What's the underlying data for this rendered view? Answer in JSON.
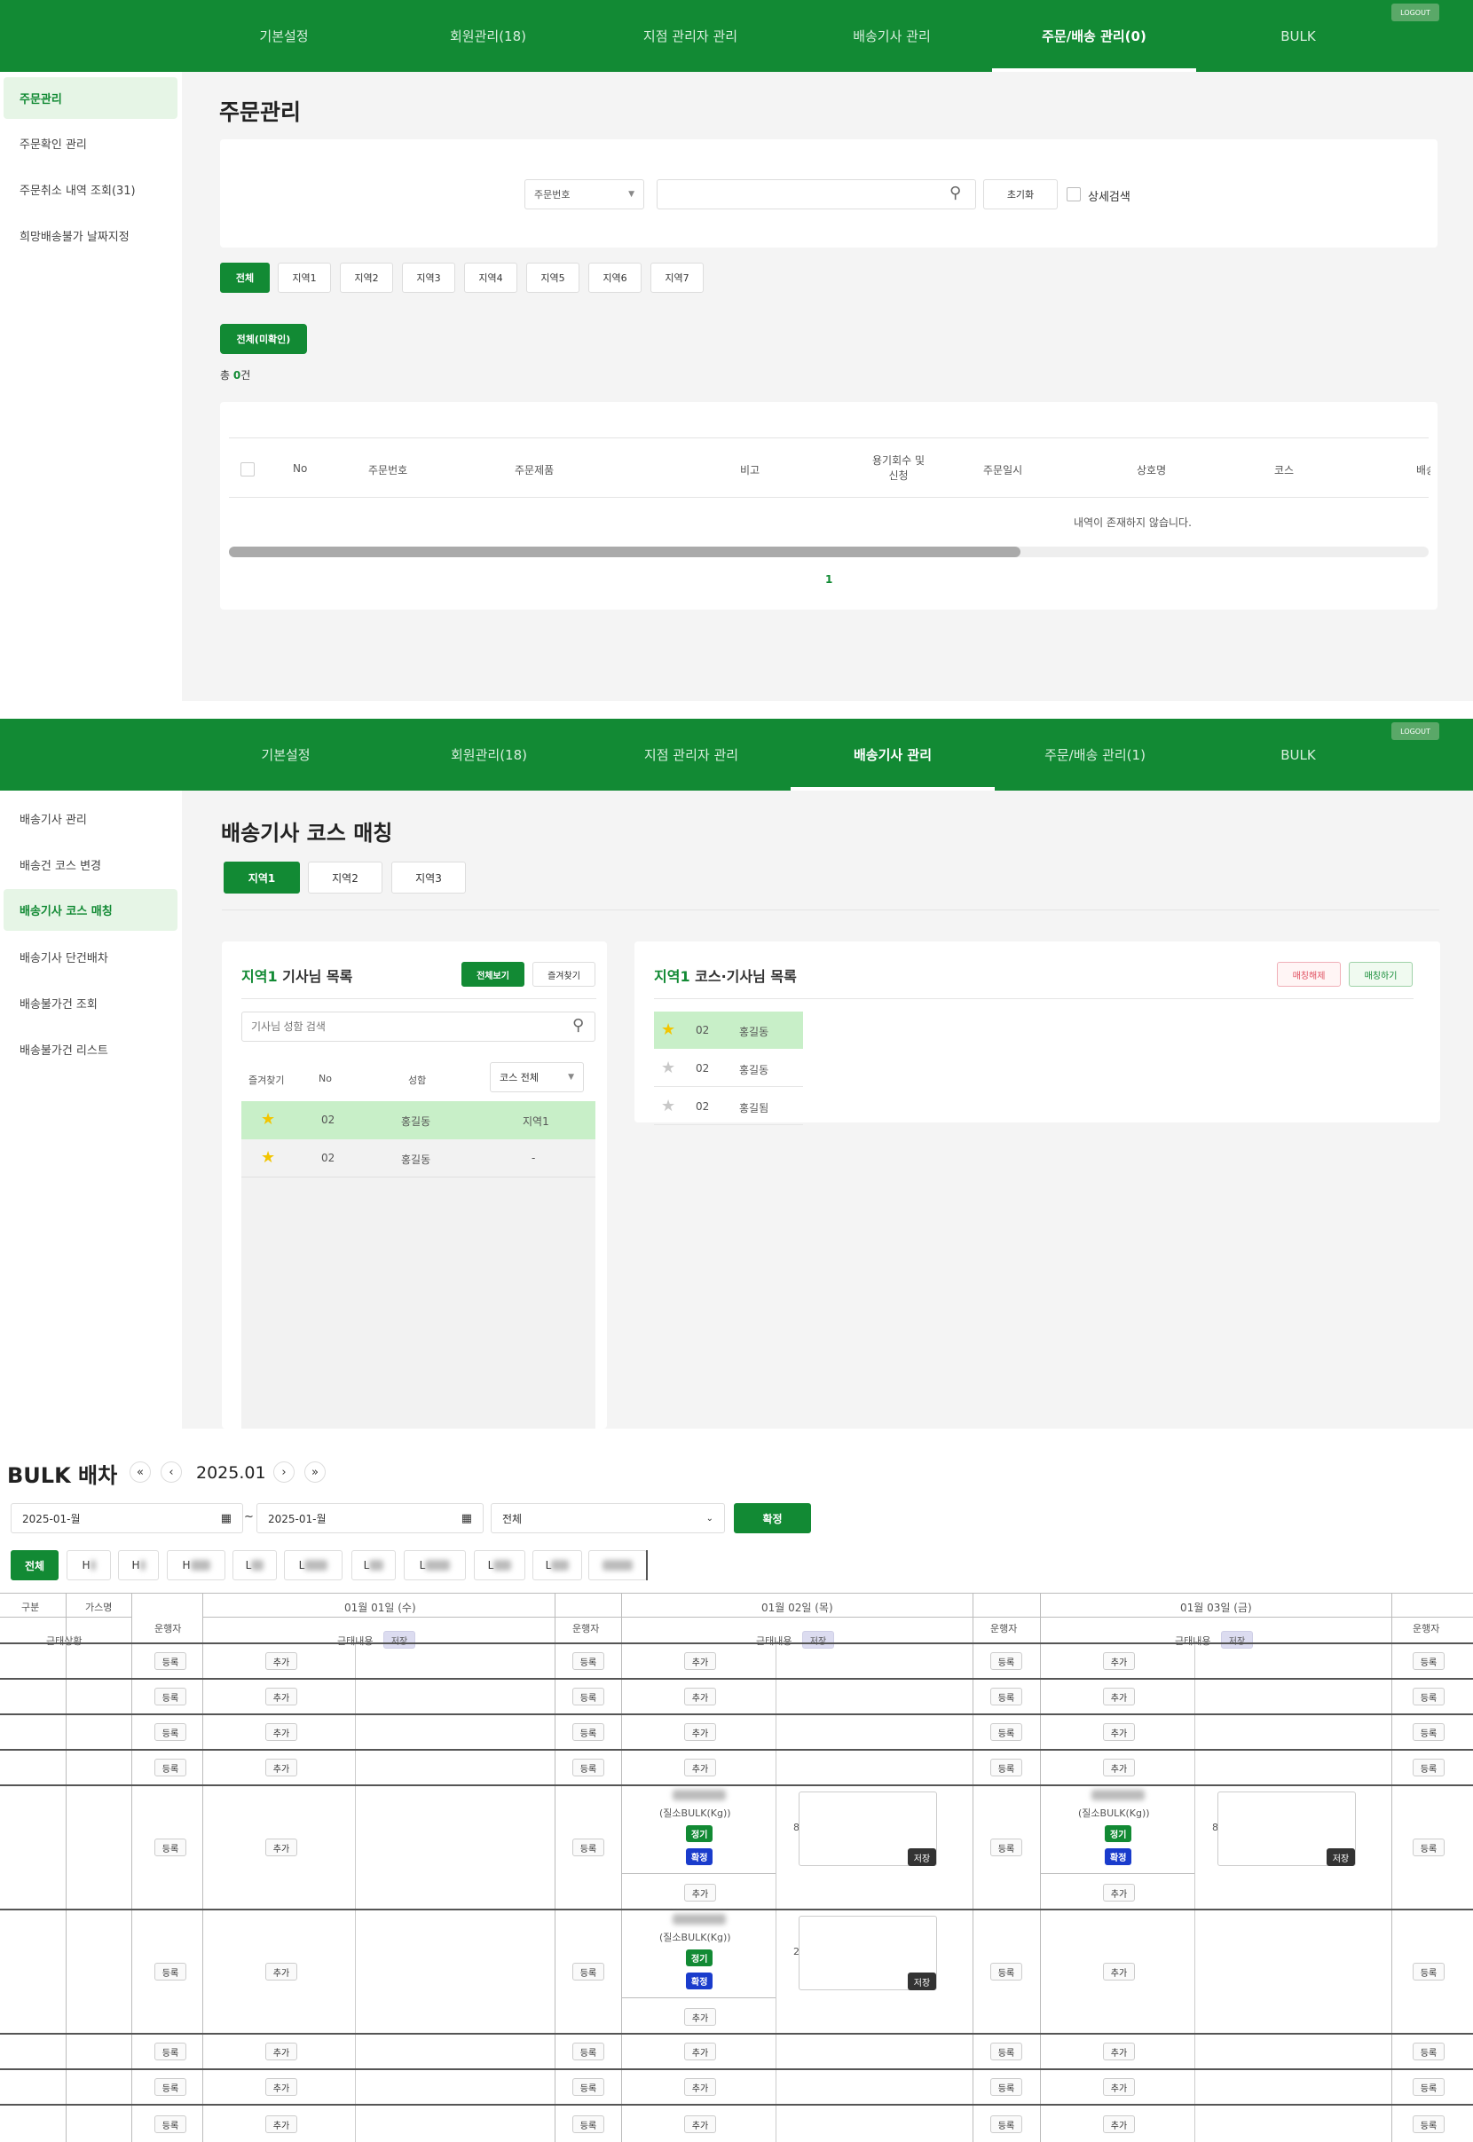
{
  "nav_items": [
    "기본설정",
    "회원관리(18)",
    "지점 관리자 관리",
    "배송기사 관리",
    "주문/배송 관리(0)",
    "BULK"
  ],
  "nav_items_2": [
    "기본설정",
    "회원관리(18)",
    "지점 관리자 관리",
    "배송기사 관리",
    "주문/배송 관리(1)",
    "BULK"
  ],
  "logout": "LOGOUT",
  "s1": {
    "sidebar": [
      "주문관리",
      "주문확인 관리",
      "주문취소 내역 조회(31)",
      "희망배송불가 날짜지정"
    ],
    "title": "주문관리",
    "search_select": "주문번호",
    "search_placeholder": "",
    "reset": "초기화",
    "detail_search": "상세검색",
    "regions": [
      "전체",
      "지역1",
      "지역2",
      "지역3",
      "지역4",
      "지역5",
      "지역6",
      "지역7"
    ],
    "unconfirmed": "전체(미확인)",
    "total_prefix": "총 ",
    "total_count": "0",
    "total_suffix": "건",
    "columns": [
      "No",
      "주문번호",
      "주문제품",
      "비고",
      "용기회수 및\n신청",
      "주문일시",
      "상호명",
      "코스",
      "배송"
    ],
    "empty": "내역이 존재하지 않습니다.",
    "page": "1"
  },
  "s2": {
    "sidebar": [
      "배송기사 관리",
      "배송건 코스 변경",
      "배송기사 코스 매칭",
      "배송기사 단건배차",
      "배송불가건 조회",
      "배송불가건 리스트"
    ],
    "title": "배송기사 코스 매칭",
    "tabs": [
      "지역1",
      "지역2",
      "지역3"
    ],
    "left_title_accent": "지역1",
    "left_title_rest": " 기사님 목록",
    "view_all": "전체보기",
    "favorites": "즐겨찾기",
    "driver_search_placeholder": "기사님 성함 검색",
    "cols": [
      "즐겨찾기",
      "No",
      "성함"
    ],
    "course_select": "코스 전체",
    "drivers": [
      {
        "no": "02",
        "name": "홍길동",
        "course": "지역1"
      },
      {
        "no": "02",
        "name": "홍길동",
        "course": "-"
      }
    ],
    "right_title_accent": "지역1",
    "right_title_rest": " 코스·기사님 목록",
    "unmatch": "매칭해제",
    "match": "매칭하기",
    "matched": [
      {
        "no": "02",
        "name": "홍길동"
      },
      {
        "no": "02",
        "name": "홍길동"
      },
      {
        "no": "02",
        "name": "홍길됨"
      }
    ]
  },
  "s3": {
    "title": "BULK 배차",
    "month": "2025.01",
    "date_from": "2025-01-월",
    "date_to": "2025-01-월",
    "date_sep": "~",
    "select": "전체",
    "confirm": "확정",
    "filters": [
      "전체",
      "H",
      "H",
      "H",
      "L",
      "L",
      "L",
      "L",
      "L",
      "L",
      ""
    ],
    "h_gubun": "구분",
    "h_gas": "가스명",
    "h_status": "근태상황",
    "h_driver": "운행자",
    "h_content": "근태내용",
    "h_save": "저장",
    "days": [
      "01월 01일 (수)",
      "01월 02일 (목)",
      "01월 03일 (금)"
    ],
    "reg": "등록",
    "add": "추가",
    "product": "(질소BULK(Kg))",
    "tag_regular": "정기",
    "tag_confirm": "확정",
    "save": "저장",
    "qty_a": "8",
    "qty_b": "8",
    "qty_c": "2",
    "colors": {
      "green": "#128a34",
      "blue": "#1a3ccc"
    }
  }
}
